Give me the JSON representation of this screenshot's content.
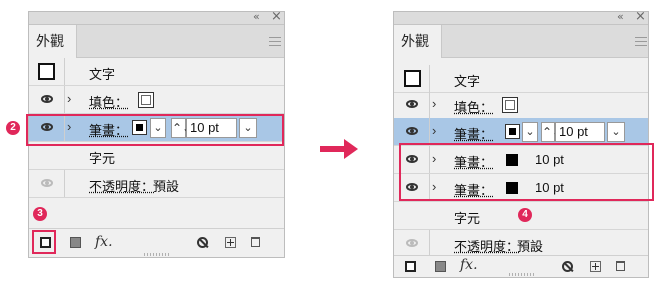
{
  "colors": {
    "accent": "#e0285a",
    "selected_row": "#a9c7e6",
    "panel_bg": "#f0f0f0"
  },
  "icons": {
    "collapse": "«",
    "close": "×",
    "chevron_right": "›",
    "dropdown": "⌄",
    "stepper": "⌃⌄"
  },
  "left_panel": {
    "tab_label": "外觀",
    "object_label": "文字",
    "fill_label": "填色：",
    "stroke_label": "筆畫：",
    "stroke_value": "10 pt",
    "characters_label": "字元",
    "opacity_label": "不透明度：",
    "opacity_value": "預設",
    "fx_label": "fx.",
    "badge_stroke": "2",
    "badge_add_stroke": "3"
  },
  "right_panel": {
    "tab_label": "外觀",
    "object_label": "文字",
    "fill_label": "填色：",
    "stroke_label": "筆畫：",
    "stroke_value": "10 pt",
    "stroke2_label": "筆畫：",
    "stroke2_value": "10 pt",
    "stroke3_label": "筆畫：",
    "stroke3_value": "10 pt",
    "characters_label": "字元",
    "opacity_label": "不透明度：",
    "opacity_value": "預設",
    "fx_label": "fx.",
    "badge_characters": "4"
  }
}
